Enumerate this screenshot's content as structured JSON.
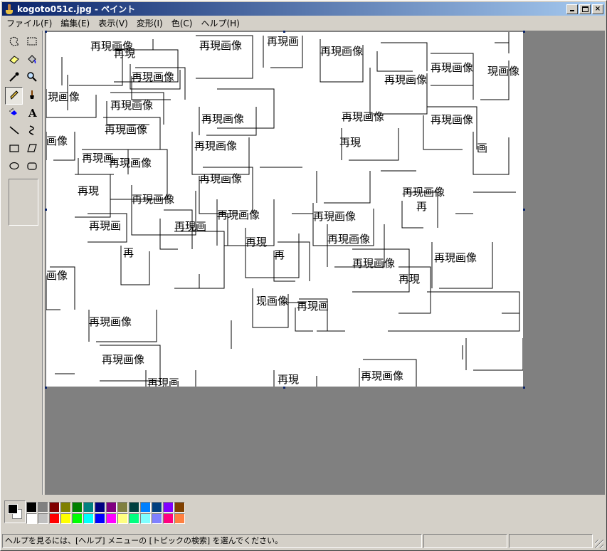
{
  "window": {
    "title": "kogoto051c.jpg - ペイント",
    "minimize_glyph": "",
    "maximize_glyph": "",
    "close_glyph": "×"
  },
  "menu": {
    "items": [
      "ファイル(F)",
      "編集(E)",
      "表示(V)",
      "変形(I)",
      "色(C)",
      "ヘルプ(H)"
    ]
  },
  "toolbox": {
    "tools": [
      {
        "name": "free-form-select-icon",
        "active": false
      },
      {
        "name": "rect-select-icon",
        "active": false
      },
      {
        "name": "eraser-icon",
        "active": false
      },
      {
        "name": "fill-bucket-icon",
        "active": false
      },
      {
        "name": "color-picker-icon",
        "active": false
      },
      {
        "name": "magnifier-icon",
        "active": false
      },
      {
        "name": "pencil-icon",
        "active": true
      },
      {
        "name": "brush-icon",
        "active": false
      },
      {
        "name": "airbrush-icon",
        "active": false
      },
      {
        "name": "text-icon",
        "active": false,
        "glyph": "A"
      },
      {
        "name": "line-icon",
        "active": false
      },
      {
        "name": "curve-icon",
        "active": false
      },
      {
        "name": "rectangle-icon",
        "active": false
      },
      {
        "name": "polygon-icon",
        "active": false
      },
      {
        "name": "ellipse-icon",
        "active": false
      },
      {
        "name": "rounded-rect-icon",
        "active": false
      }
    ]
  },
  "canvas": {
    "label": "再現画像",
    "word_fragments": [
      "再現画",
      "再現",
      "再",
      "現画像",
      "画像",
      "画",
      "现画像",
      "再现画像"
    ]
  },
  "palette": {
    "foreground": "#000000",
    "background": "#ffffff",
    "row1": [
      "#000000",
      "#808080",
      "#800000",
      "#808000",
      "#008000",
      "#008080",
      "#000080",
      "#800080",
      "#808040",
      "#004040",
      "#0080ff",
      "#004080",
      "#8000ff",
      "#804000"
    ],
    "row2": [
      "#ffffff",
      "#c0c0c0",
      "#ff0000",
      "#ffff00",
      "#00ff00",
      "#00ffff",
      "#0000ff",
      "#ff00ff",
      "#ffff80",
      "#00ff80",
      "#80ffff",
      "#8080ff",
      "#ff0080",
      "#ff8040"
    ]
  },
  "status": {
    "help_text": "ヘルプを見るには、[ヘルプ] メニューの [トピックの検索] を選んでください。",
    "cell2": "",
    "cell3": ""
  }
}
